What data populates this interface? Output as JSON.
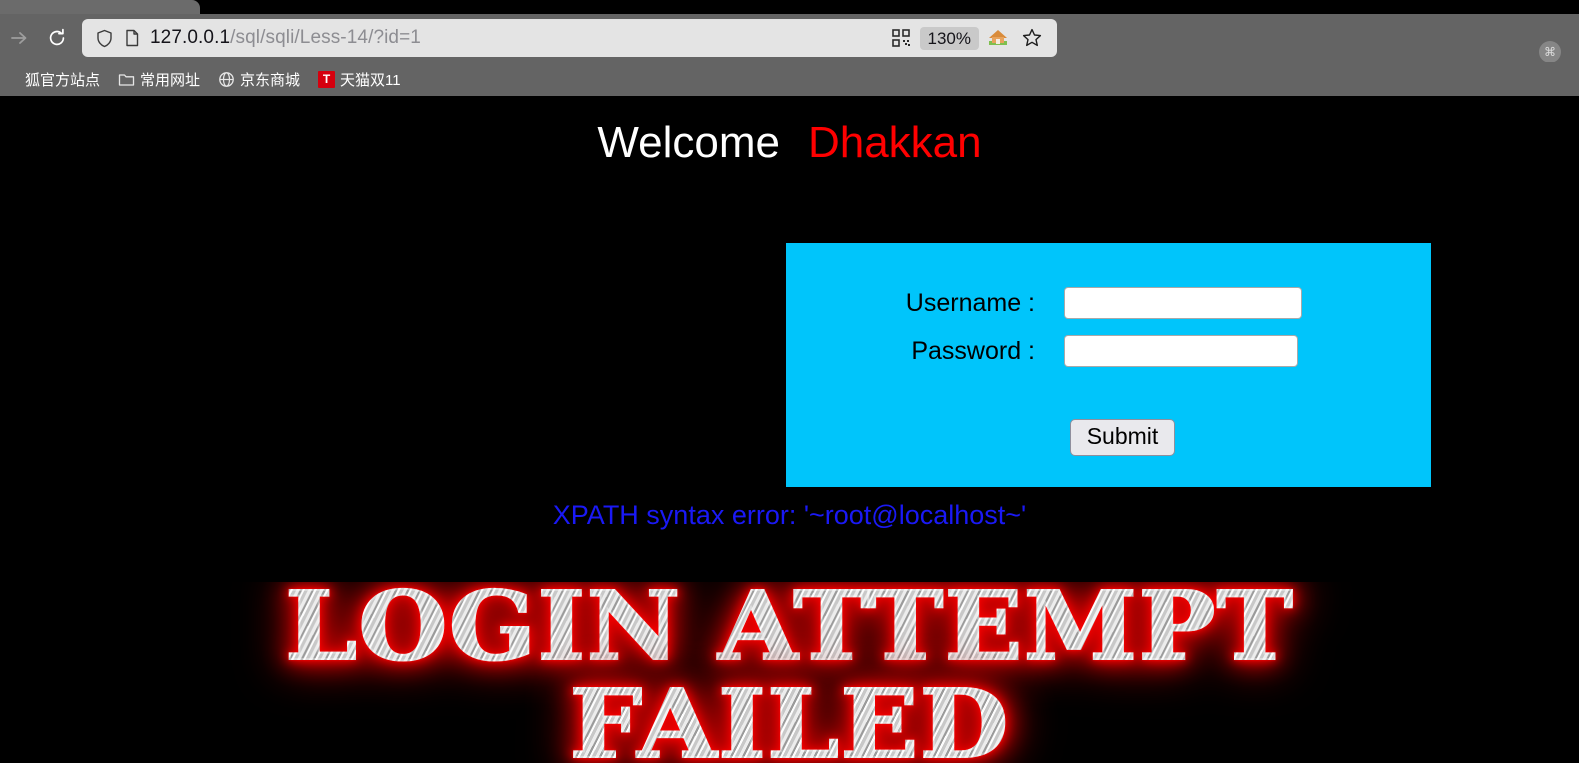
{
  "browser": {
    "nav": {
      "forward_icon": "arrow-right-icon",
      "reload_icon": "reload-icon"
    },
    "url_bar": {
      "shield_icon": "shield-icon",
      "page_icon": "document-icon",
      "host": "127.0.0.1",
      "path": "/sql/sqli/Less-14/?id=1",
      "full_url": "127.0.0.1/sql/sqli/Less-14/?id=1",
      "qr_icon": "qr-code-icon",
      "zoom_level": "130%",
      "home_icon": "home-icon",
      "bookmark_icon": "star-icon"
    },
    "command_badge": "⌘",
    "bookmarks": [
      {
        "label": "狐官方站点",
        "icon": "globe-icon"
      },
      {
        "label": "常用网址",
        "icon": "folder-icon"
      },
      {
        "label": "京东商城",
        "icon": "globe-icon"
      },
      {
        "label": "天猫双11",
        "icon": "tmall-icon"
      }
    ]
  },
  "page": {
    "heading": {
      "welcome": "Welcome",
      "name": "Dhakkan"
    },
    "login_form": {
      "username_label": "Username :",
      "username_value": "",
      "password_label": "Password :",
      "password_value": "",
      "submit_label": "Submit",
      "panel_color": "#00c5fb"
    },
    "error_message": "XPATH syntax error: '~root@localhost~'",
    "error_color": "#1a19f5",
    "failed_banner": {
      "line1": "LOGIN ATTEMPT",
      "line2": "FAILED"
    }
  }
}
